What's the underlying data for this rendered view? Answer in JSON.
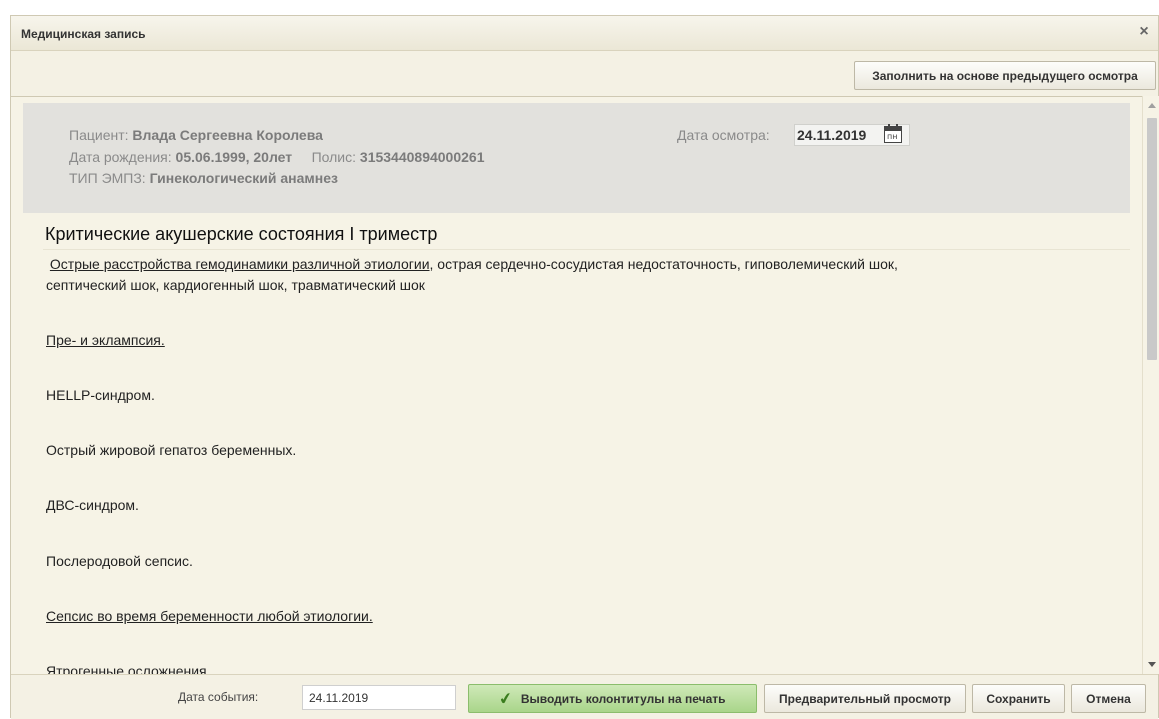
{
  "dialog": {
    "title": "Медицинская запись",
    "close_icon": "×"
  },
  "toolbar": {
    "fill_prev_label": "Заполнить на основе предыдущего осмотра"
  },
  "patient": {
    "name_label": "Пациент:",
    "name": "Влада Сергеевна Королева",
    "dob_label": "Дата рождения:",
    "dob": "05.06.1999, 20лет",
    "policy_label": "Полис:",
    "policy": "3153440894000261",
    "type_label": "ТИП ЭМПЗ:",
    "type": "Гинекологический анамнез",
    "exam_date_label": "Дата осмотра:",
    "exam_date": "24.11.2019",
    "calendar_icon_text": "пн"
  },
  "section": {
    "title": "Критические акушерские состояния I триместр",
    "items": [
      {
        "link": "Острые расстройства гемодинамики различной этиологии",
        "rest_line1": ", острая сердечно-сосудистая недостаточность, гиповолемический шок,",
        "rest_line2": "септический шок, кардиогенный шок, травматический шок"
      },
      {
        "text": "Пре- и эклампсия."
      },
      {
        "text": "HELLP-синдром."
      },
      {
        "text": "Острый жировой гепатоз беременных."
      },
      {
        "text": "ДВС-синдром."
      },
      {
        "text": "Послеродовой сепсис."
      },
      {
        "text": "Сепсис во время беременности любой этиологии."
      },
      {
        "text": "Ятрогенные осложнения"
      }
    ]
  },
  "footer": {
    "event_date_label": "Дата события:",
    "event_date": "24.11.2019",
    "print_label": "Выводить колонтитулы на печать",
    "preview_label": "Предварительный просмотр",
    "save_label": "Сохранить",
    "cancel_label": "Отмена"
  },
  "colors": {
    "panel_bg": "#f4f1e4",
    "header_box_bg": "#e2e1dd",
    "print_button_green": "#a9d58a"
  }
}
